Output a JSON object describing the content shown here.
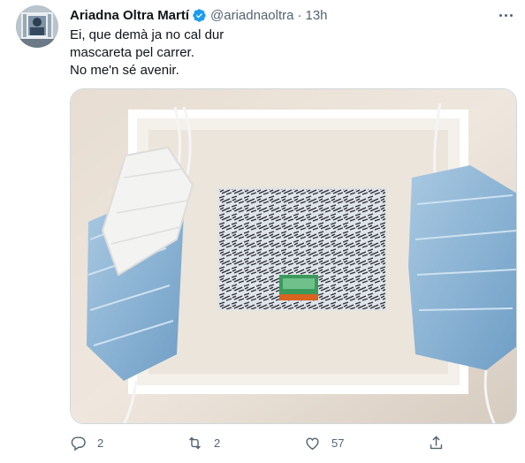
{
  "author": {
    "display_name": "Ariadna Oltra Martí",
    "handle": "@ariadnaoltra",
    "separator": "·",
    "time": "13h",
    "verified": true
  },
  "tweet": {
    "lines": [
      "Ei, que demà ja no cal dur",
      "mascareta pel carrer.",
      "No me'n sé avenir."
    ]
  },
  "media": {
    "description_icon": "photo"
  },
  "actions": {
    "reply_count": "2",
    "retweet_count": "2",
    "like_count": "57"
  },
  "colors": {
    "accent": "#1d9bf0",
    "text": "#0f1419",
    "muted": "#536471"
  }
}
